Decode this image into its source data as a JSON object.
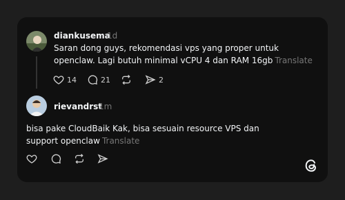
{
  "post": {
    "username": "diankusema",
    "time": "1d",
    "text": "Saran dong guys, rekomendasi vps yang proper untuk openclaw. Lagi butuh minimal vCPU 4 dan RAM 16gb",
    "translate": "Translate",
    "actions": {
      "likes": "14",
      "comments": "21",
      "shares": "2"
    }
  },
  "reply": {
    "username": "rievandrst",
    "time": "1m",
    "text": "bisa pake CloudBaik Kak, bisa sesuain resource VPS dan support openclaw",
    "translate": "Translate"
  },
  "icons": {
    "like": "heart-icon",
    "comment": "comment-icon",
    "repost": "repost-icon",
    "share": "send-icon",
    "brand": "threads-logo-icon"
  }
}
